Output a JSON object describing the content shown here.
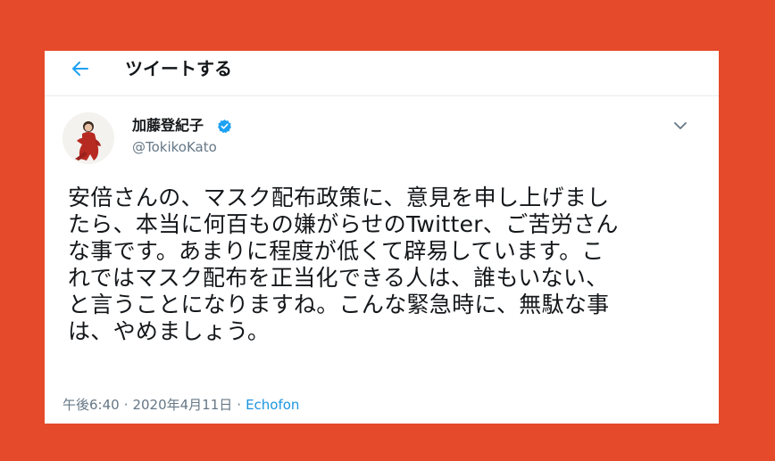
{
  "header": {
    "title": "ツイートする"
  },
  "user": {
    "display_name": "加藤登紀子",
    "handle": "@TokikoKato",
    "verified": true
  },
  "tweet": {
    "text": "安倍さんの、マスク配布政策に、意見を申し上げまし\nたら、本当に何百もの嫌がらせのTwitter、ご苦労さん\nな事です。あまりに程度が低くて辟易しています。こ\nれではマスク配布を正当化できる人は、誰もいない、\nと言うことになりますね。こんな緊急時に、無駄な事\nは、やめましょう。",
    "time": "午後6:40",
    "date": "2020年4月11日",
    "separator": "·",
    "source": "Echofon"
  },
  "icons": {
    "back": "back-arrow-icon",
    "verified": "verified-badge-icon",
    "more": "chevron-down-icon"
  },
  "colors": {
    "background": "#e54a2a",
    "accent": "#1da1f2",
    "link": "#1b95e0",
    "secondary_text": "#657786",
    "primary_text": "#14171a"
  }
}
